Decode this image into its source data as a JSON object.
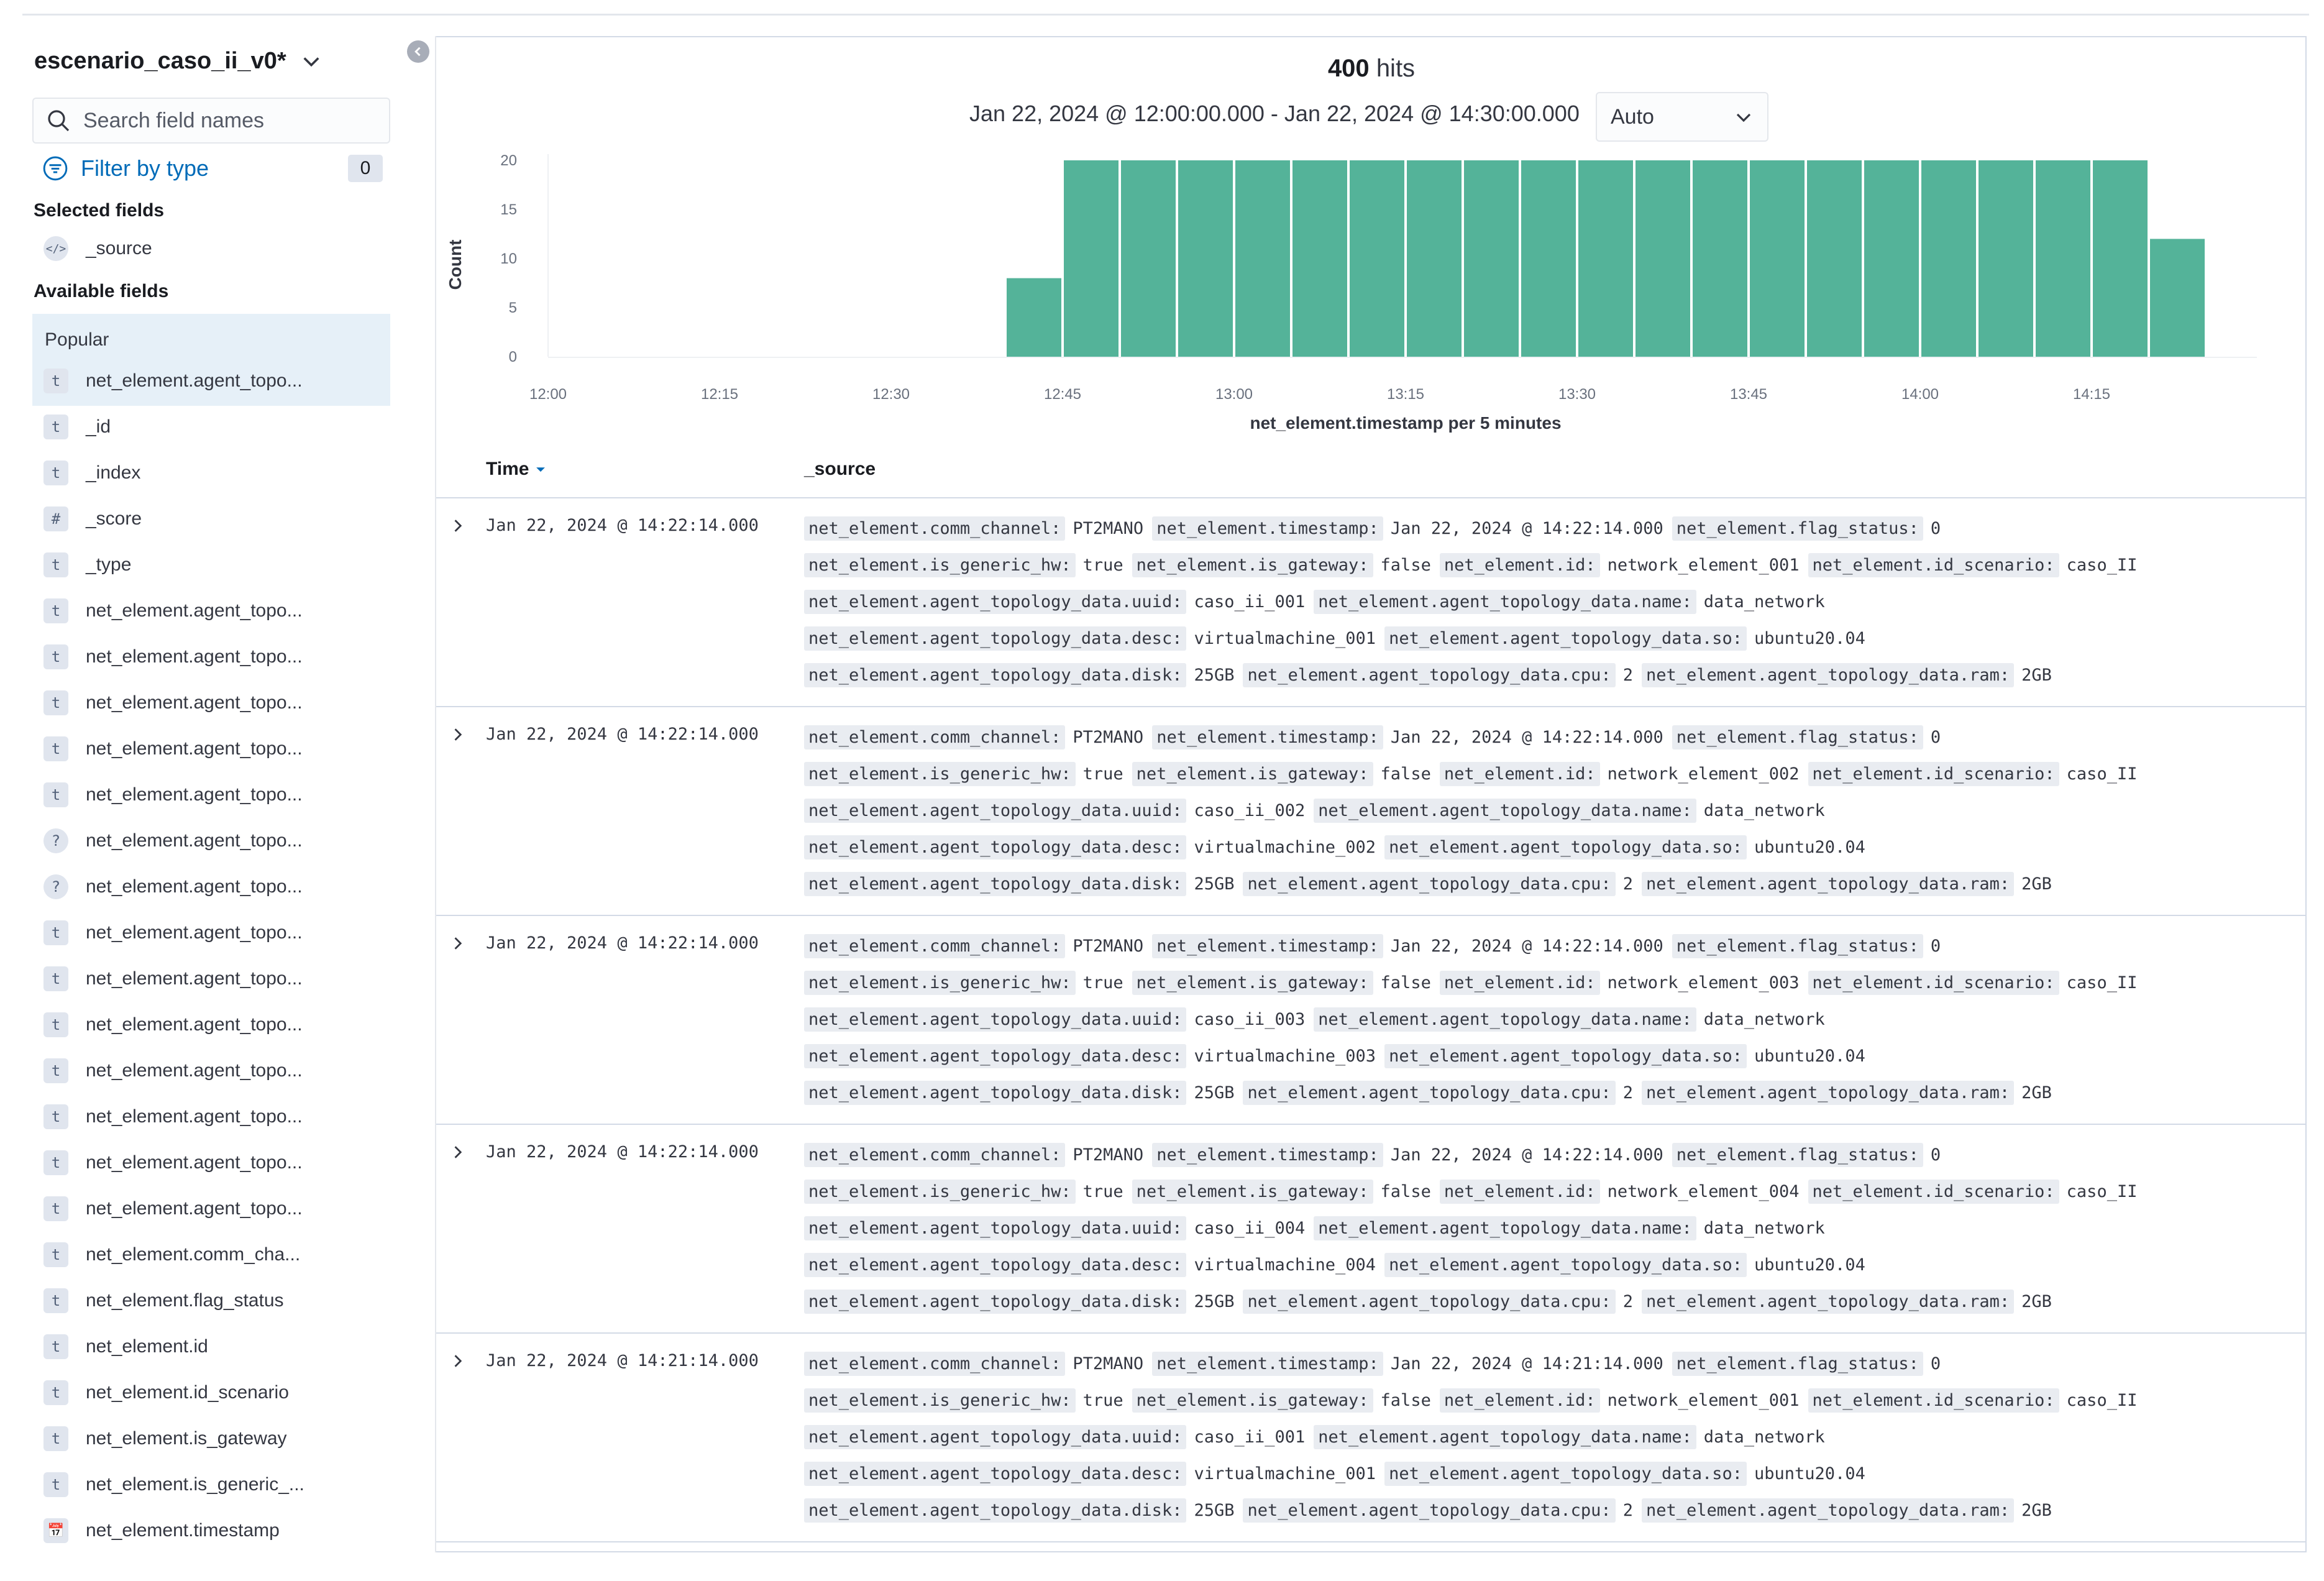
{
  "sidebar": {
    "index_pattern": "escenario_caso_ii_v0*",
    "search_placeholder": "Search field names",
    "filter_label": "Filter by type",
    "filter_count": "0",
    "selected_title": "Selected fields",
    "selected_fields": [
      {
        "type": "</>",
        "name": "_source"
      }
    ],
    "available_title": "Available fields",
    "popular_label": "Popular",
    "popular_fields": [
      {
        "type": "t",
        "name": "net_element.agent_topo..."
      }
    ],
    "fields": [
      {
        "type": "t",
        "name": "_id"
      },
      {
        "type": "t",
        "name": "_index"
      },
      {
        "type": "#",
        "name": "_score"
      },
      {
        "type": "t",
        "name": "_type"
      },
      {
        "type": "t",
        "name": "net_element.agent_topo..."
      },
      {
        "type": "t",
        "name": "net_element.agent_topo..."
      },
      {
        "type": "t",
        "name": "net_element.agent_topo..."
      },
      {
        "type": "t",
        "name": "net_element.agent_topo..."
      },
      {
        "type": "t",
        "name": "net_element.agent_topo..."
      },
      {
        "type": "?",
        "name": "net_element.agent_topo..."
      },
      {
        "type": "?",
        "name": "net_element.agent_topo..."
      },
      {
        "type": "t",
        "name": "net_element.agent_topo..."
      },
      {
        "type": "t",
        "name": "net_element.agent_topo..."
      },
      {
        "type": "t",
        "name": "net_element.agent_topo..."
      },
      {
        "type": "t",
        "name": "net_element.agent_topo..."
      },
      {
        "type": "t",
        "name": "net_element.agent_topo..."
      },
      {
        "type": "t",
        "name": "net_element.agent_topo..."
      },
      {
        "type": "t",
        "name": "net_element.agent_topo..."
      },
      {
        "type": "t",
        "name": "net_element.comm_cha..."
      },
      {
        "type": "t",
        "name": "net_element.flag_status"
      },
      {
        "type": "t",
        "name": "net_element.id"
      },
      {
        "type": "t",
        "name": "net_element.id_scenario"
      },
      {
        "type": "t",
        "name": "net_element.is_gateway"
      },
      {
        "type": "t",
        "name": "net_element.is_generic_..."
      },
      {
        "type": "📅",
        "name": "net_element.timestamp"
      }
    ]
  },
  "main": {
    "hits_count": "400",
    "hits_label": "hits",
    "time_range": "Jan 22, 2024 @ 12:00:00.000 - Jan 22, 2024 @ 14:30:00.000",
    "interval": "Auto",
    "columns": {
      "time": "Time",
      "source": "_source"
    }
  },
  "chart_data": {
    "type": "bar",
    "ylabel": "Count",
    "xlabel": "net_element.timestamp per 5 minutes",
    "ylim": [
      0,
      20
    ],
    "y_ticks": [
      "0",
      "5",
      "10",
      "15",
      "20"
    ],
    "x_ticks": [
      "12:00",
      "12:15",
      "12:30",
      "12:45",
      "13:00",
      "13:15",
      "13:30",
      "13:45",
      "14:00",
      "14:15"
    ],
    "categories": [
      "12:00",
      "12:05",
      "12:10",
      "12:15",
      "12:20",
      "12:25",
      "12:30",
      "12:35",
      "12:40",
      "12:45",
      "12:50",
      "12:55",
      "13:00",
      "13:05",
      "13:10",
      "13:15",
      "13:20",
      "13:25",
      "13:30",
      "13:35",
      "13:40",
      "13:45",
      "13:50",
      "13:55",
      "14:00",
      "14:05",
      "14:10",
      "14:15",
      "14:20"
    ],
    "values": [
      0,
      0,
      0,
      0,
      0,
      0,
      0,
      0,
      8,
      20,
      20,
      20,
      20,
      20,
      20,
      20,
      20,
      20,
      20,
      20,
      20,
      20,
      20,
      20,
      20,
      20,
      20,
      20,
      12
    ],
    "bar_color": "#54b399"
  },
  "documents": [
    {
      "time": "Jan 22, 2024 @ 14:22:14.000",
      "lines": [
        [
          [
            "net_element.comm_channel:",
            "PT2MANO"
          ],
          [
            "net_element.timestamp:",
            "Jan 22, 2024 @ 14:22:14.000"
          ],
          [
            "net_element.flag_status:",
            "0"
          ]
        ],
        [
          [
            "net_element.is_generic_hw:",
            "true"
          ],
          [
            "net_element.is_gateway:",
            "false"
          ],
          [
            "net_element.id:",
            "network_element_001"
          ],
          [
            "net_element.id_scenario:",
            "caso_II"
          ]
        ],
        [
          [
            "net_element.agent_topology_data.uuid:",
            "caso_ii_001"
          ],
          [
            "net_element.agent_topology_data.name:",
            "data_network"
          ]
        ],
        [
          [
            "net_element.agent_topology_data.desc:",
            "virtualmachine_001"
          ],
          [
            "net_element.agent_topology_data.so:",
            "ubuntu20.04"
          ]
        ],
        [
          [
            "net_element.agent_topology_data.disk:",
            "25GB"
          ],
          [
            "net_element.agent_topology_data.cpu:",
            "2"
          ],
          [
            "net_element.agent_topology_data.ram:",
            "2GB"
          ]
        ]
      ]
    },
    {
      "time": "Jan 22, 2024 @ 14:22:14.000",
      "lines": [
        [
          [
            "net_element.comm_channel:",
            "PT2MANO"
          ],
          [
            "net_element.timestamp:",
            "Jan 22, 2024 @ 14:22:14.000"
          ],
          [
            "net_element.flag_status:",
            "0"
          ]
        ],
        [
          [
            "net_element.is_generic_hw:",
            "true"
          ],
          [
            "net_element.is_gateway:",
            "false"
          ],
          [
            "net_element.id:",
            "network_element_002"
          ],
          [
            "net_element.id_scenario:",
            "caso_II"
          ]
        ],
        [
          [
            "net_element.agent_topology_data.uuid:",
            "caso_ii_002"
          ],
          [
            "net_element.agent_topology_data.name:",
            "data_network"
          ]
        ],
        [
          [
            "net_element.agent_topology_data.desc:",
            "virtualmachine_002"
          ],
          [
            "net_element.agent_topology_data.so:",
            "ubuntu20.04"
          ]
        ],
        [
          [
            "net_element.agent_topology_data.disk:",
            "25GB"
          ],
          [
            "net_element.agent_topology_data.cpu:",
            "2"
          ],
          [
            "net_element.agent_topology_data.ram:",
            "2GB"
          ]
        ]
      ]
    },
    {
      "time": "Jan 22, 2024 @ 14:22:14.000",
      "lines": [
        [
          [
            "net_element.comm_channel:",
            "PT2MANO"
          ],
          [
            "net_element.timestamp:",
            "Jan 22, 2024 @ 14:22:14.000"
          ],
          [
            "net_element.flag_status:",
            "0"
          ]
        ],
        [
          [
            "net_element.is_generic_hw:",
            "true"
          ],
          [
            "net_element.is_gateway:",
            "false"
          ],
          [
            "net_element.id:",
            "network_element_003"
          ],
          [
            "net_element.id_scenario:",
            "caso_II"
          ]
        ],
        [
          [
            "net_element.agent_topology_data.uuid:",
            "caso_ii_003"
          ],
          [
            "net_element.agent_topology_data.name:",
            "data_network"
          ]
        ],
        [
          [
            "net_element.agent_topology_data.desc:",
            "virtualmachine_003"
          ],
          [
            "net_element.agent_topology_data.so:",
            "ubuntu20.04"
          ]
        ],
        [
          [
            "net_element.agent_topology_data.disk:",
            "25GB"
          ],
          [
            "net_element.agent_topology_data.cpu:",
            "2"
          ],
          [
            "net_element.agent_topology_data.ram:",
            "2GB"
          ]
        ]
      ]
    },
    {
      "time": "Jan 22, 2024 @ 14:22:14.000",
      "lines": [
        [
          [
            "net_element.comm_channel:",
            "PT2MANO"
          ],
          [
            "net_element.timestamp:",
            "Jan 22, 2024 @ 14:22:14.000"
          ],
          [
            "net_element.flag_status:",
            "0"
          ]
        ],
        [
          [
            "net_element.is_generic_hw:",
            "true"
          ],
          [
            "net_element.is_gateway:",
            "false"
          ],
          [
            "net_element.id:",
            "network_element_004"
          ],
          [
            "net_element.id_scenario:",
            "caso_II"
          ]
        ],
        [
          [
            "net_element.agent_topology_data.uuid:",
            "caso_ii_004"
          ],
          [
            "net_element.agent_topology_data.name:",
            "data_network"
          ]
        ],
        [
          [
            "net_element.agent_topology_data.desc:",
            "virtualmachine_004"
          ],
          [
            "net_element.agent_topology_data.so:",
            "ubuntu20.04"
          ]
        ],
        [
          [
            "net_element.agent_topology_data.disk:",
            "25GB"
          ],
          [
            "net_element.agent_topology_data.cpu:",
            "2"
          ],
          [
            "net_element.agent_topology_data.ram:",
            "2GB"
          ]
        ]
      ]
    },
    {
      "time": "Jan 22, 2024 @ 14:21:14.000",
      "lines": [
        [
          [
            "net_element.comm_channel:",
            "PT2MANO"
          ],
          [
            "net_element.timestamp:",
            "Jan 22, 2024 @ 14:21:14.000"
          ],
          [
            "net_element.flag_status:",
            "0"
          ]
        ],
        [
          [
            "net_element.is_generic_hw:",
            "true"
          ],
          [
            "net_element.is_gateway:",
            "false"
          ],
          [
            "net_element.id:",
            "network_element_001"
          ],
          [
            "net_element.id_scenario:",
            "caso_II"
          ]
        ],
        [
          [
            "net_element.agent_topology_data.uuid:",
            "caso_ii_001"
          ],
          [
            "net_element.agent_topology_data.name:",
            "data_network"
          ]
        ],
        [
          [
            "net_element.agent_topology_data.desc:",
            "virtualmachine_001"
          ],
          [
            "net_element.agent_topology_data.so:",
            "ubuntu20.04"
          ]
        ],
        [
          [
            "net_element.agent_topology_data.disk:",
            "25GB"
          ],
          [
            "net_element.agent_topology_data.cpu:",
            "2"
          ],
          [
            "net_element.agent_topology_data.ram:",
            "2GB"
          ]
        ]
      ]
    }
  ]
}
